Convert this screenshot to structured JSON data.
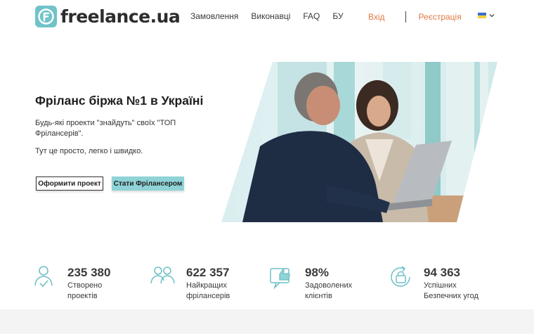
{
  "header": {
    "logo_text": "freelance.ua",
    "nav": [
      "Замовлення",
      "Виконавці",
      "FAQ",
      "БУ"
    ],
    "login": "Вхід",
    "register": "Реєстрація",
    "lang_icon": "ukraine-flag-icon"
  },
  "hero": {
    "title": "Фріланс біржа №1 в Україні",
    "subtitle": "Будь-які проекти \"знайдуть\" своїх \"ТОП Фрілансерів\".",
    "subtitle2": "Тут це просто, легко і швидко.",
    "btn_order": "Оформити проект",
    "btn_freelancer": "Стати Фрілансером",
    "image_icon": "freelancers-working-photo"
  },
  "stats": [
    {
      "icon": "person-check-icon",
      "value": "235 380",
      "label1": "Створено",
      "label2": "проектів"
    },
    {
      "icon": "people-group-icon",
      "value": "622 357",
      "label1": "Найкращих",
      "label2": "фрілансерів"
    },
    {
      "icon": "thumbs-up-icon",
      "value": "98%",
      "label1": "Задоволених",
      "label2": "клієнтів"
    },
    {
      "icon": "secure-lock-icon",
      "value": "94 363",
      "label1": "Успішних",
      "label2": "Безпечних угод"
    }
  ],
  "colors": {
    "accent_teal": "#8fd3d7",
    "logo_teal": "#6fc3c9",
    "link_orange": "#e07a45",
    "icon_teal": "#6ec0c6"
  }
}
